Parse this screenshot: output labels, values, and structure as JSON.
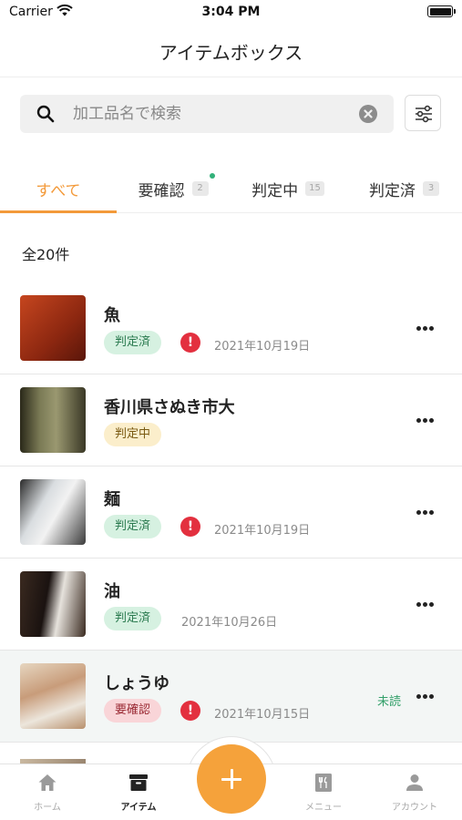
{
  "status_bar": {
    "carrier": "Carrier",
    "time": "3:04 PM"
  },
  "header": {
    "title": "アイテムボックス"
  },
  "search": {
    "placeholder": "加工品名で検索",
    "value": ""
  },
  "tabs": [
    {
      "label": "すべて",
      "badge": "",
      "active": true,
      "has_dot": false
    },
    {
      "label": "要確認",
      "badge": "2",
      "active": false,
      "has_dot": true
    },
    {
      "label": "判定中",
      "badge": "15",
      "active": false,
      "has_dot": false
    },
    {
      "label": "判定済",
      "badge": "3",
      "active": false,
      "has_dot": false
    }
  ],
  "total_label": "全20件",
  "items": [
    {
      "name": "魚",
      "status": "判定済",
      "status_type": "done",
      "alert": true,
      "date": "2021年10月19日",
      "unread": "",
      "thumb_colors": [
        "#b2381c",
        "#6e1a0c"
      ]
    },
    {
      "name": "香川県さぬき市大",
      "status": "判定中",
      "status_type": "pending",
      "alert": false,
      "date": "",
      "unread": "",
      "thumb_colors": [
        "#6b6a4a",
        "#2c2a1c"
      ]
    },
    {
      "name": "麺",
      "status": "判定済",
      "status_type": "done",
      "alert": true,
      "date": "2021年10月19日",
      "unread": "",
      "thumb_colors": [
        "#c9cdd0",
        "#3a3a3a"
      ]
    },
    {
      "name": "油",
      "status": "判定済",
      "status_type": "done",
      "alert": false,
      "date": "2021年10月26日",
      "unread": "",
      "thumb_colors": [
        "#2b1e18",
        "#d8d4cf"
      ]
    },
    {
      "name": "しょうゆ",
      "status": "要確認",
      "status_type": "check",
      "alert": true,
      "date": "2021年10月15日",
      "unread": "未読",
      "thumb_colors": [
        "#c7a37d",
        "#e9e0d2"
      ]
    }
  ],
  "bottom_nav": [
    {
      "label": "ホーム",
      "icon": "home-icon",
      "active": false
    },
    {
      "label": "アイテム",
      "icon": "box-icon",
      "active": true
    },
    {
      "label": "メニュー",
      "icon": "menu-book-icon",
      "active": false
    },
    {
      "label": "アカウント",
      "icon": "person-icon",
      "active": false
    }
  ],
  "colors": {
    "accent": "#f39a3a",
    "fab": "#f5a23b",
    "alert": "#e3303f",
    "unread": "#33a06a"
  }
}
